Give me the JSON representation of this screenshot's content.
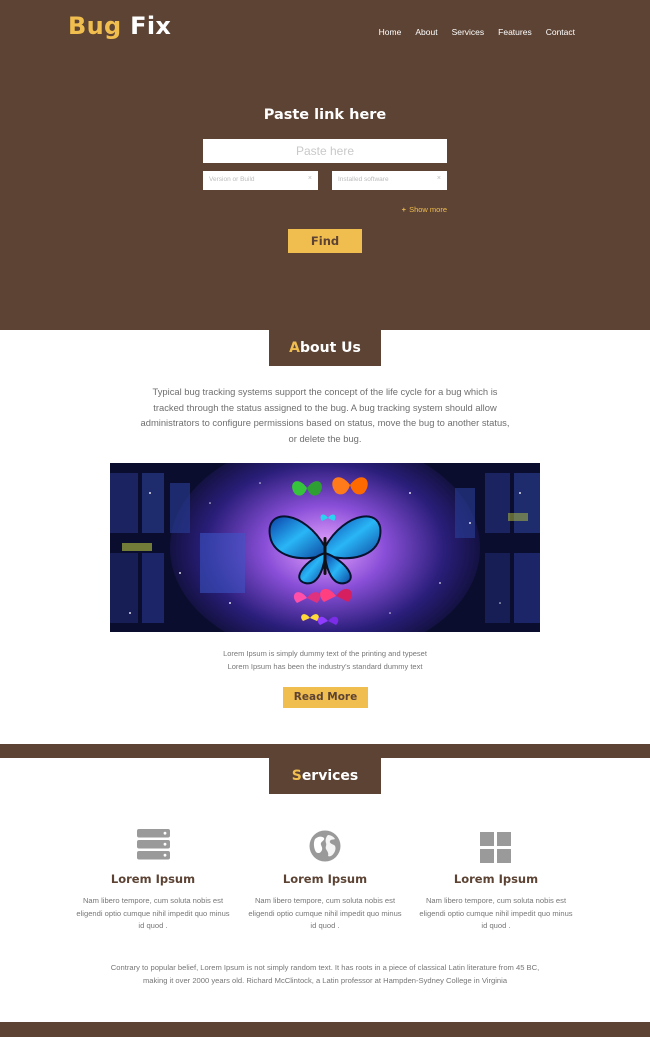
{
  "brand": {
    "word1": "Bug",
    "word2": "Fix"
  },
  "nav": [
    "Home",
    "About",
    "Services",
    "Features",
    "Contact"
  ],
  "hero": {
    "title": "Paste link here",
    "input_placeholder": "Paste here",
    "select1": "Version or Build",
    "select2": "Installed software",
    "show_more": "Show more",
    "find": "Find"
  },
  "about": {
    "heading_first": "A",
    "heading_rest": "bout Us",
    "text": "Typical bug tracking systems support the concept of the life cycle for a bug which is tracked through the status assigned to the bug. A bug tracking system should allow administrators to configure permissions based on status, move the bug to another status, or delete the bug.",
    "lorem_line1": "Lorem Ipsum is simply dummy text of the printing and typeset",
    "lorem_line2": "Lorem Ipsum has been the industry's standard dummy text",
    "read_more": "Read More"
  },
  "services": {
    "heading_first": "S",
    "heading_rest": "ervices",
    "items": [
      {
        "icon": "server-icon",
        "title": "Lorem Ipsum",
        "text": "Nam libero tempore, cum soluta nobis est eligendi optio cumque nihil impedit quo minus id quod ."
      },
      {
        "icon": "globe-icon",
        "title": "Lorem Ipsum",
        "text": "Nam libero tempore, cum soluta nobis est eligendi optio cumque nihil impedit quo minus id quod ."
      },
      {
        "icon": "grid-icon",
        "title": "Lorem Ipsum",
        "text": "Nam libero tempore, cum soluta nobis est eligendi optio cumque nihil impedit quo minus id quod ."
      }
    ],
    "footer_text": "Contrary to popular belief, Lorem Ipsum is not simply random text. It has roots in a piece of classical Latin literature from 45 BC, making it over 2000 years old. Richard McClintock, a Latin professor at Hampden-Sydney College in Virginia"
  },
  "colors": {
    "brown": "#5c4334",
    "gold": "#f0bd4f",
    "icon_gray": "#9a9a9a"
  }
}
